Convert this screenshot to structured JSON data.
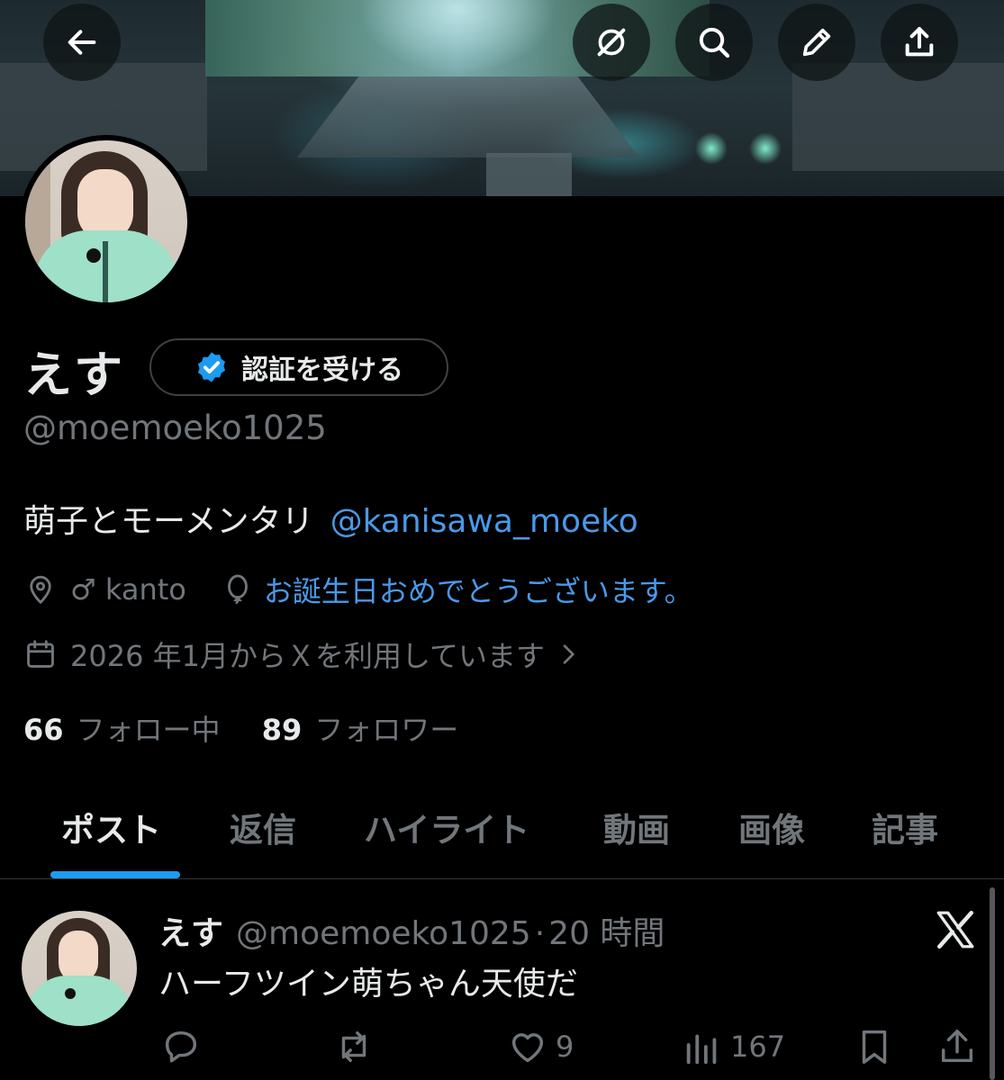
{
  "header": {
    "back_icon": "arrow-left-icon",
    "grok_icon": "grok-icon",
    "search_icon": "search-icon",
    "edit_icon": "pencil-icon",
    "share_icon": "share-icon"
  },
  "profile": {
    "display_name": "えす",
    "verify_button_label": "認証を受ける",
    "handle": "@moemoeko1025",
    "bio_text": "萌子とモーメンタリ",
    "bio_mention": "@kanisawa_moeko",
    "location": "♂ kanto",
    "birthday_text": "お誕生日おめでとうございます。",
    "joined_text": "2026 年1月からＸを利用しています",
    "following_count": "66",
    "following_label": "フォロー中",
    "followers_count": "89",
    "followers_label": "フォロワー"
  },
  "tabs": [
    {
      "label": "ポスト",
      "active": true
    },
    {
      "label": "返信",
      "active": false
    },
    {
      "label": "ハイライト",
      "active": false
    },
    {
      "label": "動画",
      "active": false
    },
    {
      "label": "画像",
      "active": false
    },
    {
      "label": "記事",
      "active": false
    }
  ],
  "post": {
    "name": "えす",
    "handle": "@moemoeko1025",
    "separator": "·",
    "time": "20 時間",
    "text": "ハーフツイン萌ちゃん天使だ",
    "likes": "9",
    "views": "167"
  },
  "colors": {
    "background": "#000000",
    "text": "#e7e9ea",
    "muted": "#71767b",
    "link": "#4a99e9",
    "accent": "#1d9bf0"
  }
}
